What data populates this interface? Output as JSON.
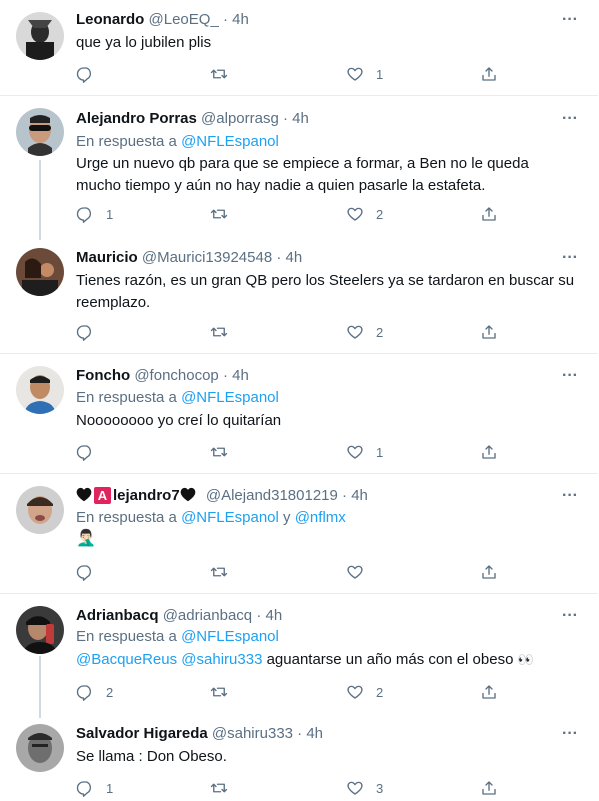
{
  "replying_to_label": "En respuesta a",
  "tweets": [
    {
      "name": "Leonardo",
      "handle": "@LeoEQ_",
      "sep": "·",
      "time": "4h",
      "text": "que ya lo jubilen plis",
      "replies": "",
      "retweets": "",
      "likes": "1"
    },
    {
      "name": "Alejandro Porras",
      "handle": "@alporrasg",
      "sep": "·",
      "time": "4h",
      "reply_to": "@NFLEspanol",
      "text": "Urge un nuevo qb para que se empiece a formar, a Ben no le queda mucho tiempo y aún no hay nadie a quien pasarle la estafeta.",
      "replies": "1",
      "retweets": "",
      "likes": "2"
    },
    {
      "name": "Mauricio",
      "handle": "@Maurici13924548",
      "sep": "·",
      "time": "4h",
      "text": "Tienes razón, es un gran QB pero los Steelers ya se tardaron en buscar su reemplazo.",
      "replies": "",
      "retweets": "",
      "likes": "2"
    },
    {
      "name": "Foncho",
      "handle": "@fonchocop",
      "sep": "·",
      "time": "4h",
      "reply_to": "@NFLEspanol",
      "text": "Noooooooo yo creí lo quitarían",
      "replies": "",
      "retweets": "",
      "likes": "1"
    },
    {
      "name_prefix_letter": "A",
      "name": "lejandro7",
      "handle": "@Alejand31801219",
      "sep": "·",
      "time": "4h",
      "reply_to": "@NFLEspanol",
      "reply_conj": "y",
      "reply_to_2": "@nflmx",
      "text": "🤦🏻‍♂️",
      "replies": "",
      "retweets": "",
      "likes": ""
    },
    {
      "name": "Adrianbacq",
      "handle": "@adrianbacq",
      "sep": "·",
      "time": "4h",
      "reply_to": "@NFLEspanol",
      "mention_1": "@BacqueReus",
      "mention_2": "@sahiru333",
      "text": "aguantarse un año más con el obeso",
      "text_emoji": "👀",
      "replies": "2",
      "retweets": "",
      "likes": "2"
    },
    {
      "name": "Salvador Higareda",
      "handle": "@sahiru333",
      "sep": "·",
      "time": "4h",
      "text": "Se llama : Don Obeso.",
      "replies": "1",
      "retweets": "",
      "likes": "3"
    }
  ],
  "colors": {
    "accent": "#1da1f2",
    "muted": "#5b7083",
    "divider": "#e6ecf0",
    "badge_red": "#e0245e"
  },
  "icons": [
    "reply-icon",
    "retweet-icon",
    "like-icon",
    "share-icon",
    "more-icon",
    "black-heart-icon"
  ]
}
